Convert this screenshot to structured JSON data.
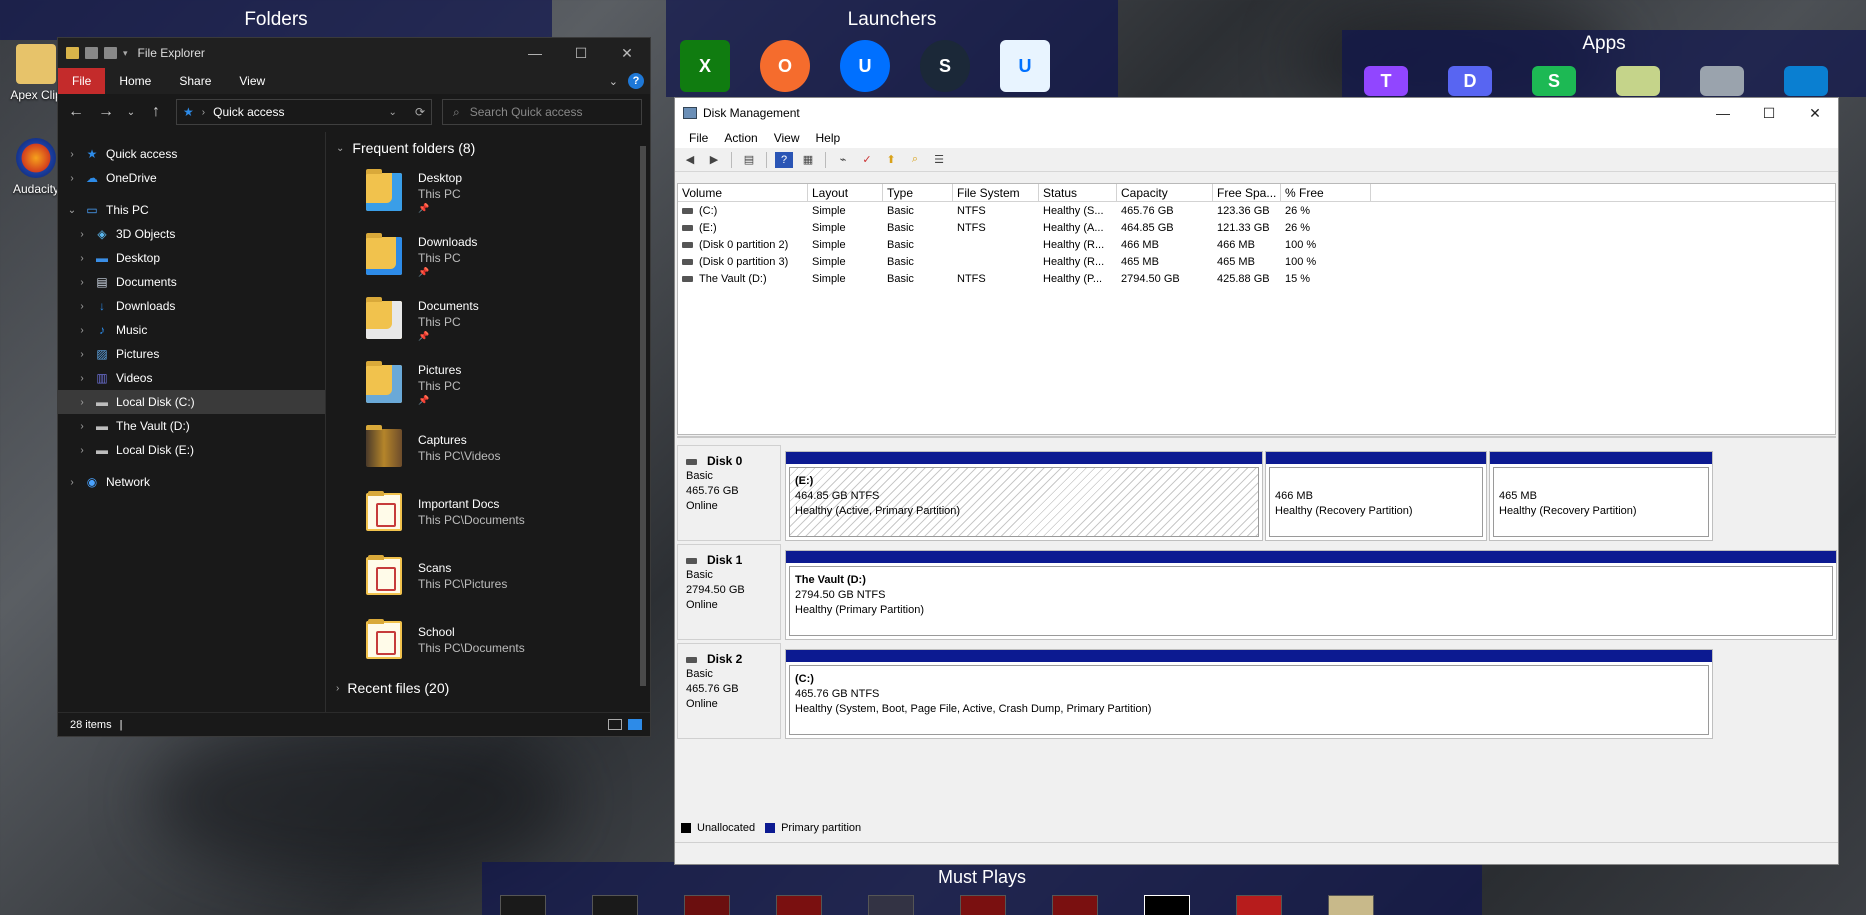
{
  "fences": {
    "folders_title": "Folders",
    "launchers_title": "Launchers",
    "apps_title": "Apps",
    "must_plays_title": "Must Plays"
  },
  "desktop_icons": [
    {
      "label": "Apex Clip"
    },
    {
      "label": "Audacity"
    }
  ],
  "launcher_icons": [
    "xbox-icon",
    "origin-icon",
    "uplay-icon",
    "steam-icon",
    "uplay-pc-icon"
  ],
  "app_icons": [
    "twitch-icon",
    "discord-icon",
    "spotify-icon",
    "notepad-icon",
    "computer-icon",
    "phone-icon"
  ],
  "file_explorer": {
    "title": "File Explorer",
    "ribbon_tabs": [
      "File",
      "Home",
      "Share",
      "View"
    ],
    "address": "Quick access",
    "search_placeholder": "Search Quick access",
    "nav_items": [
      {
        "label": "Quick access",
        "level": 0,
        "icon": "star-icon",
        "color": "#2d8be8"
      },
      {
        "label": "OneDrive",
        "level": 0,
        "icon": "cloud-icon",
        "color": "#2d8be8"
      },
      {
        "label": "This PC",
        "level": 0,
        "icon": "computer-icon",
        "color": "#4aa3ff"
      },
      {
        "label": "3D Objects",
        "level": 1,
        "icon": "cube-icon",
        "color": "#5bb8f0"
      },
      {
        "label": "Desktop",
        "level": 1,
        "icon": "desktop-icon",
        "color": "#3a8ee6"
      },
      {
        "label": "Documents",
        "level": 1,
        "icon": "document-icon",
        "color": "#cfd8e6"
      },
      {
        "label": "Downloads",
        "level": 1,
        "icon": "download-icon",
        "color": "#2d8be8"
      },
      {
        "label": "Music",
        "level": 1,
        "icon": "music-icon",
        "color": "#2d8be8"
      },
      {
        "label": "Pictures",
        "level": 1,
        "icon": "pictures-icon",
        "color": "#5fa7e8"
      },
      {
        "label": "Videos",
        "level": 1,
        "icon": "videos-icon",
        "color": "#6b6fd4"
      },
      {
        "label": "Local Disk (C:)",
        "level": 1,
        "icon": "drive-icon",
        "color": "#bdbdbd",
        "selected": true
      },
      {
        "label": "The Vault (D:)",
        "level": 1,
        "icon": "drive-icon",
        "color": "#bdbdbd"
      },
      {
        "label": "Local Disk (E:)",
        "level": 1,
        "icon": "drive-icon",
        "color": "#bdbdbd"
      },
      {
        "label": "Network",
        "level": 0,
        "icon": "network-icon",
        "color": "#4aa3ff"
      }
    ],
    "frequent_header": "Frequent folders (8)",
    "folders": [
      {
        "name": "Desktop",
        "location": "This PC",
        "pinned": true,
        "type": "desktop"
      },
      {
        "name": "Downloads",
        "location": "This PC",
        "pinned": true,
        "type": "downloads"
      },
      {
        "name": "Documents",
        "location": "This PC",
        "pinned": true,
        "type": "documents"
      },
      {
        "name": "Pictures",
        "location": "This PC",
        "pinned": true,
        "type": "pictures"
      },
      {
        "name": "Captures",
        "location": "This PC\\Videos",
        "pinned": false,
        "type": "folder"
      },
      {
        "name": "Important Docs",
        "location": "This PC\\Documents",
        "pinned": false,
        "type": "doc"
      },
      {
        "name": "Scans",
        "location": "This PC\\Pictures",
        "pinned": false,
        "type": "doc"
      },
      {
        "name": "School",
        "location": "This PC\\Documents",
        "pinned": false,
        "type": "doc"
      }
    ],
    "recent_header": "Recent files (20)",
    "status_items": "28 items"
  },
  "disk_management": {
    "title": "Disk Management",
    "menus": [
      "File",
      "Action",
      "View",
      "Help"
    ],
    "columns": [
      "Volume",
      "Layout",
      "Type",
      "File System",
      "Status",
      "Capacity",
      "Free Spa...",
      "% Free"
    ],
    "volumes": [
      {
        "volume": "(C:)",
        "layout": "Simple",
        "type": "Basic",
        "fs": "NTFS",
        "status": "Healthy (S...",
        "capacity": "465.76 GB",
        "free": "123.36 GB",
        "pct": "26 %"
      },
      {
        "volume": "(E:)",
        "layout": "Simple",
        "type": "Basic",
        "fs": "NTFS",
        "status": "Healthy (A...",
        "capacity": "464.85 GB",
        "free": "121.33 GB",
        "pct": "26 %"
      },
      {
        "volume": "(Disk 0 partition 2)",
        "layout": "Simple",
        "type": "Basic",
        "fs": "",
        "status": "Healthy (R...",
        "capacity": "466 MB",
        "free": "466 MB",
        "pct": "100 %"
      },
      {
        "volume": "(Disk 0 partition 3)",
        "layout": "Simple",
        "type": "Basic",
        "fs": "",
        "status": "Healthy (R...",
        "capacity": "465 MB",
        "free": "465 MB",
        "pct": "100 %"
      },
      {
        "volume": "The Vault (D:)",
        "layout": "Simple",
        "type": "Basic",
        "fs": "NTFS",
        "status": "Healthy (P...",
        "capacity": "2794.50 GB",
        "free": "425.88 GB",
        "pct": "15 %"
      }
    ],
    "disks": [
      {
        "name": "Disk 0",
        "kind": "Basic",
        "size": "465.76 GB",
        "state": "Online",
        "partitions": [
          {
            "title": "(E:)",
            "size": "464.85 GB NTFS",
            "status": "Healthy (Active, Primary Partition)",
            "hatched": true
          },
          {
            "title": "",
            "size": "466 MB",
            "status": "Healthy (Recovery Partition)",
            "hatched": false
          },
          {
            "title": "",
            "size": "465 MB",
            "status": "Healthy (Recovery Partition)",
            "hatched": false
          }
        ]
      },
      {
        "name": "Disk 1",
        "kind": "Basic",
        "size": "2794.50 GB",
        "state": "Online",
        "partitions": [
          {
            "title": "The Vault  (D:)",
            "size": "2794.50 GB NTFS",
            "status": "Healthy (Primary Partition)",
            "hatched": false
          }
        ]
      },
      {
        "name": "Disk 2",
        "kind": "Basic",
        "size": "465.76 GB",
        "state": "Online",
        "partitions": [
          {
            "title": "(C:)",
            "size": "465.76 GB NTFS",
            "status": "Healthy (System, Boot, Page File, Active, Crash Dump, Primary Partition)",
            "hatched": false
          }
        ]
      }
    ],
    "legend": [
      {
        "label": "Unallocated",
        "color": "#000000"
      },
      {
        "label": "Primary partition",
        "color": "#0c1a91"
      }
    ]
  },
  "colors": {
    "fence_bg": "#10164e",
    "partition_bar": "#0c1a91",
    "file_tab": "#c42b2b",
    "accent_blue": "#1e78d7"
  }
}
